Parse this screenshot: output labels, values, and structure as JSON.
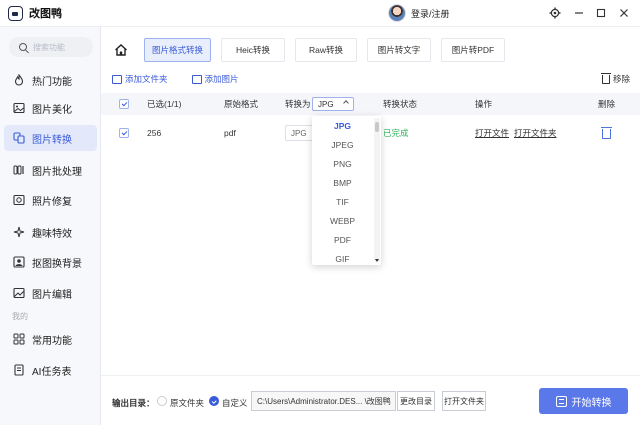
{
  "app": {
    "title": "改图鸭",
    "login_label": "登录/注册"
  },
  "window_controls": [
    "settings-icon",
    "minimize-icon",
    "maximize-icon",
    "close-icon"
  ],
  "sidebar": {
    "search_placeholder": "搜索功能",
    "items": [
      {
        "label": "热门功能",
        "icon": "flame-icon"
      },
      {
        "label": "图片美化",
        "icon": "image-beautify-icon"
      },
      {
        "label": "图片转换",
        "icon": "convert-icon",
        "active": true
      },
      {
        "label": "图片批处理",
        "icon": "batch-icon"
      },
      {
        "label": "照片修复",
        "icon": "repair-icon"
      },
      {
        "label": "趣味特效",
        "icon": "sparkle-icon"
      },
      {
        "label": "抠图换背景",
        "icon": "cutout-icon"
      },
      {
        "label": "图片编辑",
        "icon": "edit-icon"
      }
    ],
    "section_mine": "我的",
    "mine_items": [
      {
        "label": "常用功能",
        "icon": "grid-icon"
      },
      {
        "label": "AI任务表",
        "icon": "ai-task-icon"
      }
    ]
  },
  "tabs": [
    {
      "label": "图片格式转换",
      "active": true
    },
    {
      "label": "Heic转换"
    },
    {
      "label": "Raw转换"
    },
    {
      "label": "图片转文字"
    },
    {
      "label": "图片转PDF"
    }
  ],
  "toolbar": {
    "add_folder": "添加文件夹",
    "add_image": "添加图片",
    "remove": "移除"
  },
  "table": {
    "headers": {
      "selected": "已选(1/1)",
      "original_format": "原始格式",
      "convert_to": "转换为",
      "status": "转换状态",
      "actions": "操作",
      "delete": "删除"
    },
    "header_format_value": "JPG",
    "rows": [
      {
        "name": "256",
        "format": "pdf",
        "target": "JPG",
        "status": "已完成",
        "open_file": "打开文件",
        "open_folder": "打开文件夹"
      }
    ]
  },
  "dropdown": {
    "selected": "JPG",
    "options": [
      "JPG",
      "JPEG",
      "PNG",
      "BMP",
      "TIF",
      "WEBP",
      "PDF",
      "GIF"
    ]
  },
  "bottom": {
    "output_label": "输出目录：",
    "option_original": "原文件夹",
    "option_custom": "自定义",
    "path": "C:\\Users\\Administrator.DES... \\改图鸭",
    "change_dir": "更改目录",
    "open_folder": "打开文件夹",
    "start": "开始转换"
  },
  "colors": {
    "accent": "#3a5bd9",
    "start_button": "#5b78ea",
    "success": "#33b25f"
  }
}
